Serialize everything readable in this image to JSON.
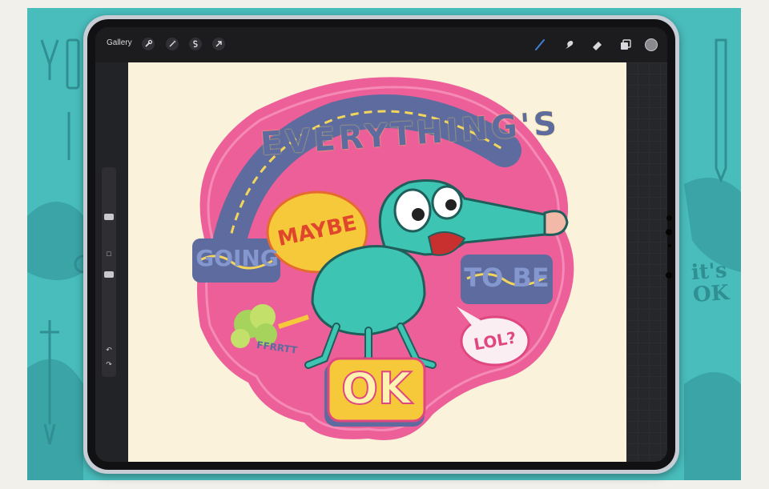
{
  "app": {
    "gallery_label": "Gallery"
  },
  "toolbar": {
    "left_tools": [
      "wrench-icon",
      "magic-wand-icon",
      "selection-icon",
      "transform-arrow-icon"
    ],
    "right_tools": [
      "brush-icon",
      "smudge-icon",
      "eraser-icon",
      "layers-icon"
    ],
    "active_tool": "brush-icon",
    "current_color": "#8a8a8e"
  },
  "sidebar": {
    "undo_glyph": "↶",
    "redo_glyph": "↷",
    "modify_glyph": "□"
  },
  "artwork": {
    "lines": [
      "EVERYTHING'S",
      "GOING",
      "TO BE",
      "OK"
    ],
    "bubble_maybe": "MAYBE",
    "bubble_lol": "LOL?",
    "fart_text": "FFRRTT"
  },
  "background_art": {
    "text": "it's OK"
  },
  "colors": {
    "teal_bg": "#49bcbc",
    "pink": "#ec5f98",
    "cream": "#fbf2dc",
    "creature": "#3ec4b2",
    "yellow": "#f6c93a",
    "accent_blue": "#3f7fd6"
  }
}
